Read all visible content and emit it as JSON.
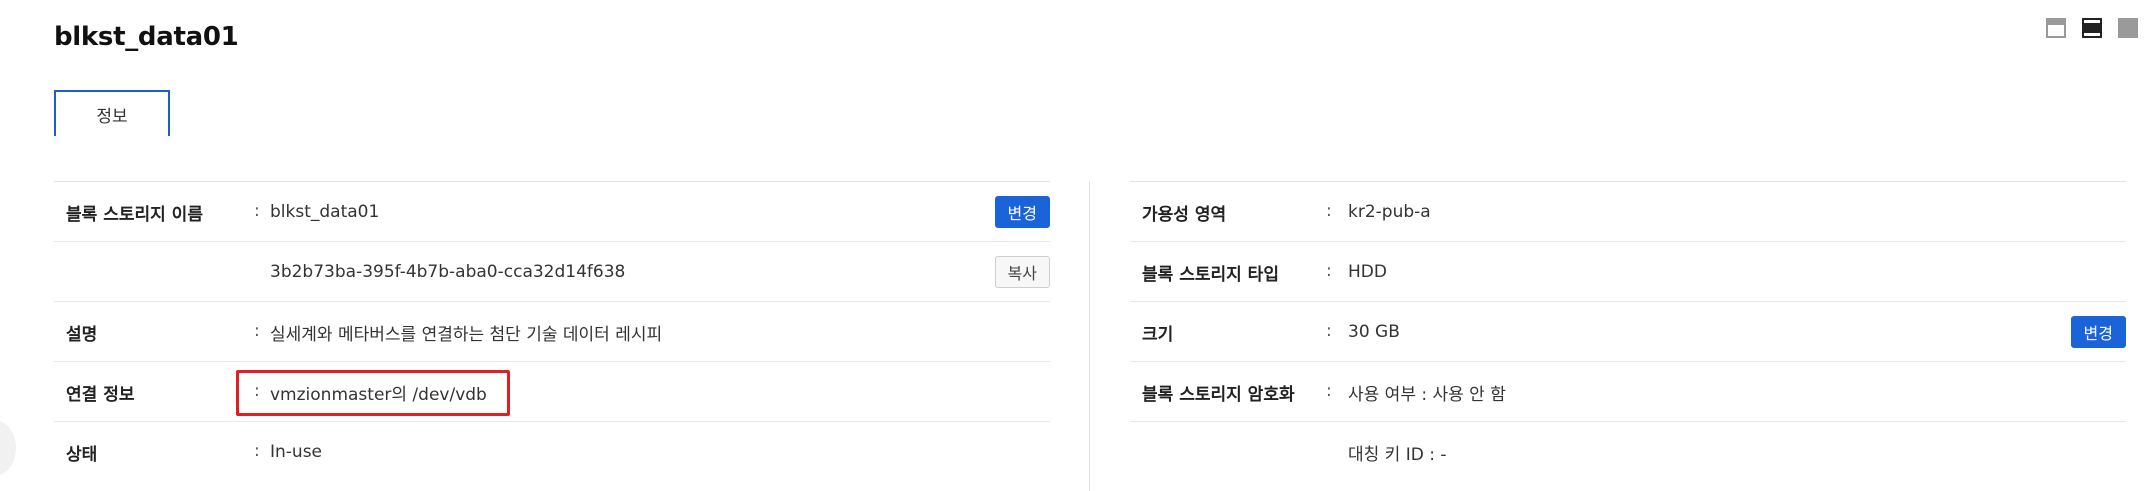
{
  "header": {
    "title": "blkst_data01"
  },
  "tabs": [
    {
      "label": "정보",
      "active": true
    }
  ],
  "left_panel": {
    "rows": [
      {
        "label": "블록 스토리지 이름",
        "value": "blkst_data01",
        "button": "변경"
      },
      {
        "label": "",
        "value": "3b2b73ba-395f-4b7b-aba0-cca32d14f638",
        "button": "복사"
      },
      {
        "label": "설명",
        "value": "실세계와 메타버스를 연결하는 첨단 기술 데이터 레시피"
      },
      {
        "label": "연결 정보",
        "value": "vmzionmaster의 /dev/vdb"
      },
      {
        "label": "상태",
        "value": "In-use"
      }
    ]
  },
  "right_panel": {
    "rows": [
      {
        "label": "가용성 영역",
        "value": "kr2-pub-a"
      },
      {
        "label": "블록 스토리지 타입",
        "value": "HDD"
      },
      {
        "label": "크기",
        "value": "30 GB",
        "button": "변경"
      },
      {
        "label": "블록 스토리지 암호화",
        "value": "사용 여부 : 사용 안 함"
      },
      {
        "label": "",
        "value": "대칭 키 ID : -"
      }
    ]
  },
  "colon": ":",
  "colors": {
    "accent": "#1a63d8",
    "tab_border": "#1f5fbf",
    "highlight": "#e02020"
  },
  "icons": [
    "layout-top-icon",
    "layout-middle-icon",
    "layout-bottom-icon"
  ]
}
